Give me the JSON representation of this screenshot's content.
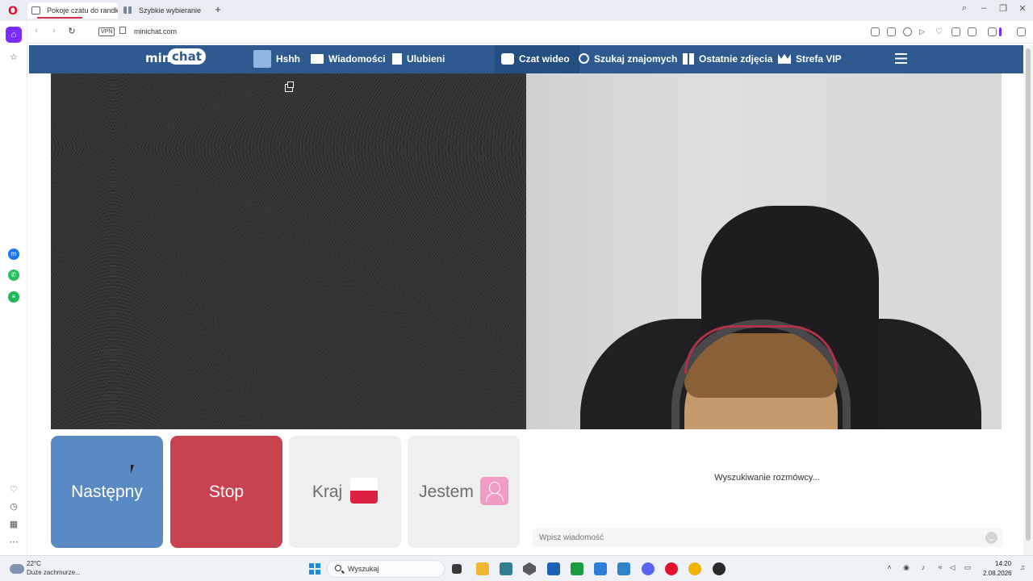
{
  "browser": {
    "tabs": [
      {
        "label": "Pokoje czatu do randk"
      },
      {
        "label": "Szybkie wybieranie"
      }
    ],
    "new_tab": "+",
    "address": {
      "vpn": "VPN",
      "url": "minichat.com"
    }
  },
  "site": {
    "logo": {
      "mini": "mini",
      "chat": "chat"
    },
    "nav": {
      "profile": "Hshh",
      "messages": "Wiadomości",
      "favorites": "Ulubieni",
      "video_chat": "Czat wideo",
      "find_friends": "Szukaj znajomych",
      "recent_photos": "Ostatnie zdjęcia",
      "vip": "Strefa VIP"
    },
    "controls": {
      "next": "Następny",
      "stop": "Stop",
      "country": "Kraj",
      "gender": "Jestem"
    },
    "chat": {
      "status": "Wyszukiwanie rozmówcy...",
      "input_placeholder": "Wpisz wiadomość"
    }
  },
  "taskbar": {
    "weather": {
      "temp": "22°C",
      "desc": "Duże zachmurze..."
    },
    "search_label": "Wyszukaj",
    "clock": {
      "time": "14:20",
      "date": "2.08.2026"
    }
  },
  "colors": {
    "header": "#2e5a8f",
    "next_button": "#5a8ac4",
    "stop_button": "#c84250",
    "accent_opera": "#e1122a"
  }
}
